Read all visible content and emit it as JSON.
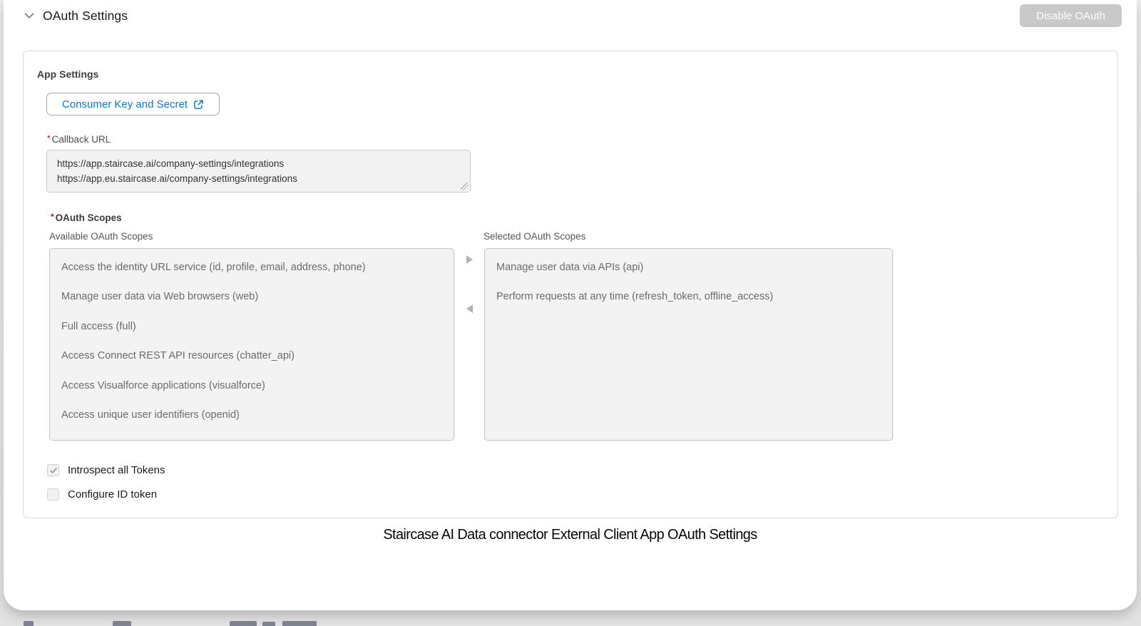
{
  "header": {
    "title": "OAuth Settings",
    "disable_button_label": "Disable OAuth"
  },
  "panel": {
    "section_title": "App Settings",
    "consumer_button_label": "Consumer Key and Secret",
    "callback": {
      "label": "Callback URL",
      "required": true,
      "urls": [
        "https://app.staircase.ai/company-settings/integrations",
        "https://app.eu.staircase.ai/company-settings/integrations"
      ]
    },
    "scopes": {
      "label": "OAuth Scopes",
      "required": true,
      "available_label": "Available OAuth Scopes",
      "selected_label": "Selected OAuth Scopes",
      "available": [
        "Access the identity URL service (id, profile, email, address, phone)",
        "Manage user data via Web browsers (web)",
        "Full access (full)",
        "Access Connect REST API resources (chatter_api)",
        "Access Visualforce applications (visualforce)",
        "Access unique user identifiers (openid)"
      ],
      "selected": [
        "Manage user data via APIs (api)",
        "Perform requests at any time (refresh_token, offline_access)"
      ]
    },
    "checkboxes": [
      {
        "label": "Introspect all Tokens",
        "checked": true
      },
      {
        "label": "Configure ID token",
        "checked": false
      }
    ]
  },
  "caption": "Staircase AI Data connector External Client App OAuth Settings",
  "icons": {
    "chevron": "chevron-down-icon",
    "external_link": "external-link-icon",
    "move_right": "move-right-arrow-icon",
    "move_left": "move-left-arrow-icon",
    "checkmark": "check-icon"
  },
  "colors": {
    "link_blue": "#0b78d0",
    "required_red": "#d40000",
    "disabled_button_gray": "#c9c9c9",
    "listbox_bg": "#f3f3f3",
    "scope_text": "#6b6b6b",
    "card_bg": "#ffffff",
    "page_bg": "#e7e7e7"
  }
}
